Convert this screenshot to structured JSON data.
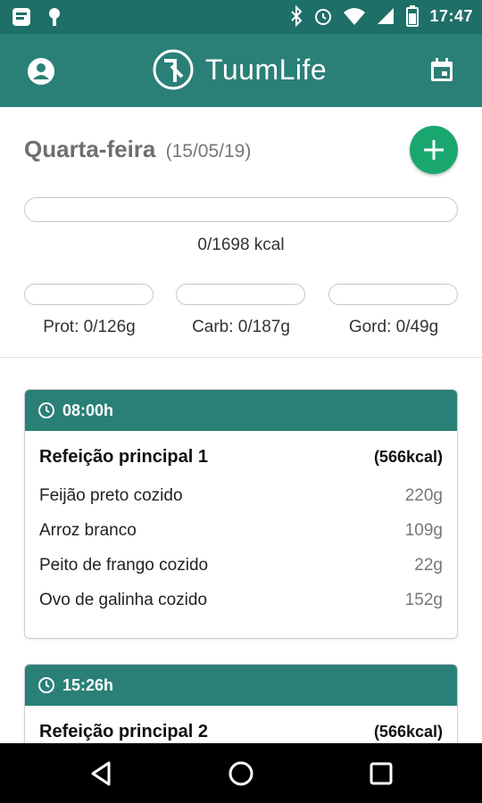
{
  "status_bar": {
    "time": "17:47",
    "icons": [
      "notification-icon",
      "android-icon",
      "bluetooth-icon",
      "alarm-icon",
      "wifi-icon",
      "signal-icon",
      "battery-icon"
    ]
  },
  "app_bar": {
    "title": "TuumLife",
    "left_icon": "account-icon",
    "right_icon": "calendar-icon",
    "colors": {
      "primary": "#2a8077",
      "status": "#1e6f68"
    }
  },
  "day": {
    "weekday": "Quarta-feira",
    "date": "(15/05/19)",
    "add_icon": "plus-icon",
    "add_color": "#19a76f"
  },
  "totals": {
    "kcal_text": "0/1698 kcal",
    "kcal_progress": 0,
    "macros": [
      {
        "label": "Prot: 0/126g",
        "progress": 0
      },
      {
        "label": "Carb: 0/187g",
        "progress": 0
      },
      {
        "label": "Gord: 0/49g",
        "progress": 0
      }
    ]
  },
  "meals": [
    {
      "time": "08:00h",
      "name": "Refeição principal 1",
      "kcal": "(566kcal)",
      "foods": [
        {
          "name": "Feijão preto cozido",
          "qty": "220g"
        },
        {
          "name": "Arroz branco",
          "qty": "109g"
        },
        {
          "name": "Peito de frango cozido",
          "qty": "22g"
        },
        {
          "name": "Ovo de galinha cozido",
          "qty": "152g"
        }
      ]
    },
    {
      "time": "15:26h",
      "name": "Refeição principal 2",
      "kcal": "(566kcal)",
      "foods": []
    }
  ],
  "nav": {
    "back": "back-icon",
    "home": "home-icon",
    "recents": "recents-icon"
  }
}
